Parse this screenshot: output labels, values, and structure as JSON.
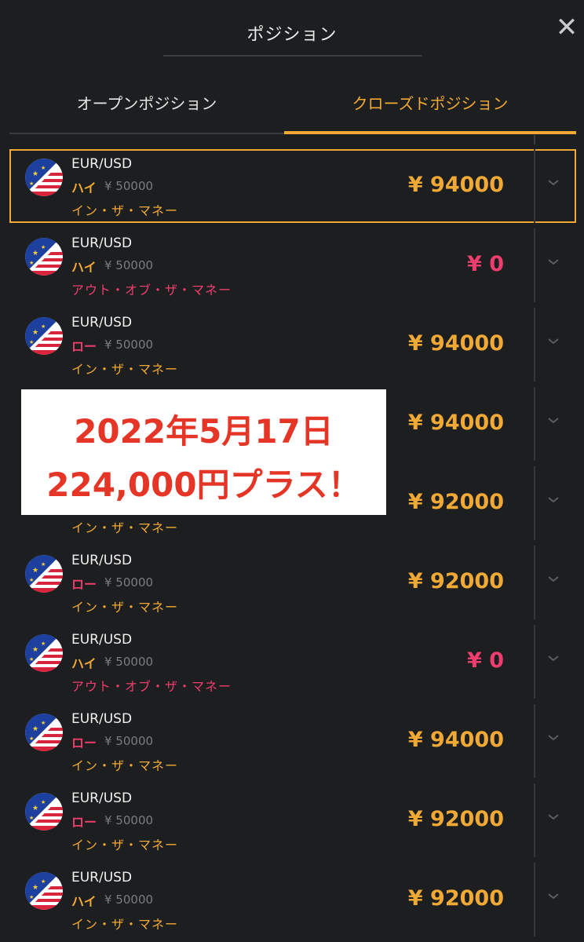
{
  "header": {
    "title": "ポジション",
    "close_label": "✕"
  },
  "tabs": {
    "open": "オープンポジション",
    "closed": "クローズドポジション"
  },
  "overlay": {
    "line1": "2022年5月17日",
    "line2": "224,000円プラス！"
  },
  "colors": {
    "accent": "#f0a934",
    "loss": "#ef3d6e",
    "background": "#1d1e20"
  },
  "positions": [
    {
      "pair": "EUR/USD",
      "direction": "ハイ",
      "dir_type": "high",
      "stake": "¥ 50000",
      "result": "イン・ザ・マネー",
      "result_type": "in",
      "payout": "¥ 94000",
      "selected": true
    },
    {
      "pair": "EUR/USD",
      "direction": "ハイ",
      "dir_type": "high",
      "stake": "¥ 50000",
      "result": "アウト・オブ・ザ・マネー",
      "result_type": "out",
      "payout": "¥ 0"
    },
    {
      "pair": "EUR/USD",
      "direction": "ロー",
      "dir_type": "low",
      "stake": "¥ 50000",
      "result": "イン・ザ・マネー",
      "result_type": "in",
      "payout": "¥ 94000"
    },
    {
      "pair": "",
      "direction": "",
      "dir_type": "high",
      "stake": "",
      "result": "",
      "result_type": "in",
      "payout": "¥ 94000"
    },
    {
      "pair": "",
      "direction": "",
      "dir_type": "high",
      "stake": "",
      "result": "イン・ザ・マネー",
      "result_type": "in",
      "payout": "¥ 92000"
    },
    {
      "pair": "EUR/USD",
      "direction": "ロー",
      "dir_type": "low",
      "stake": "¥ 50000",
      "result": "イン・ザ・マネー",
      "result_type": "in",
      "payout": "¥ 92000"
    },
    {
      "pair": "EUR/USD",
      "direction": "ハイ",
      "dir_type": "high",
      "stake": "¥ 50000",
      "result": "アウト・オブ・ザ・マネー",
      "result_type": "out",
      "payout": "¥ 0"
    },
    {
      "pair": "EUR/USD",
      "direction": "ロー",
      "dir_type": "low",
      "stake": "¥ 50000",
      "result": "イン・ザ・マネー",
      "result_type": "in",
      "payout": "¥ 94000"
    },
    {
      "pair": "EUR/USD",
      "direction": "ロー",
      "dir_type": "low",
      "stake": "¥ 50000",
      "result": "イン・ザ・マネー",
      "result_type": "in",
      "payout": "¥ 92000"
    },
    {
      "pair": "EUR/USD",
      "direction": "ハイ",
      "dir_type": "high",
      "stake": "¥ 50000",
      "result": "イン・ザ・マネー",
      "result_type": "in",
      "payout": "¥ 92000"
    }
  ]
}
